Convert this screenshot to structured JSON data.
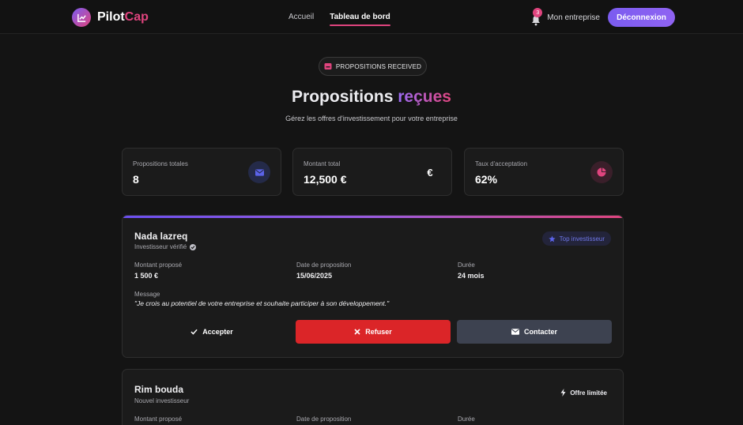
{
  "brand": {
    "name_main": "Pilot",
    "name_accent": "Cap"
  },
  "nav": {
    "links": [
      {
        "label": "Accueil",
        "active": false
      },
      {
        "label": "Tableau de bord",
        "active": true
      }
    ],
    "notification_count": "3",
    "company_label": "Mon entreprise",
    "logout_label": "Déconnexion"
  },
  "hero": {
    "pill": "PROPOSITIONS RECEIVED",
    "title_main": "Propositions",
    "title_accent": "reçues",
    "subtitle": "Gérez les offres d'investissement pour votre entreprise"
  },
  "stats": [
    {
      "label": "Propositions totales",
      "value": "8",
      "icon": "envelope-icon",
      "color": "#5b63e8"
    },
    {
      "label": "Montant total",
      "value": "12,500 €",
      "icon": "euro-icon",
      "color": "#ffffff"
    },
    {
      "label": "Taux d'acceptation",
      "value": "62%",
      "icon": "pie-chart-icon",
      "color": "#e0447e"
    }
  ],
  "proposals": [
    {
      "name": "Nada lazreq",
      "subtitle": "Investisseur vérifié",
      "tag": "Top investisseur",
      "amount_label": "Montant proposé",
      "amount": "1 500 €",
      "date_label": "Date de proposition",
      "date": "15/06/2025",
      "duration_label": "Durée",
      "duration": "24 mois",
      "message_label": "Message",
      "message": "\"Je crois au potentiel de votre entreprise et souhaite participer à son développement.\"",
      "actions": {
        "accept": "Accepter",
        "refuse": "Refuser",
        "contact": "Contacter"
      }
    },
    {
      "name": "Rim bouda",
      "subtitle": "Nouvel investisseur",
      "tag": "Offre limitée",
      "amount_label": "Montant proposé",
      "date_label": "Date de proposition",
      "duration_label": "Durée"
    }
  ]
}
